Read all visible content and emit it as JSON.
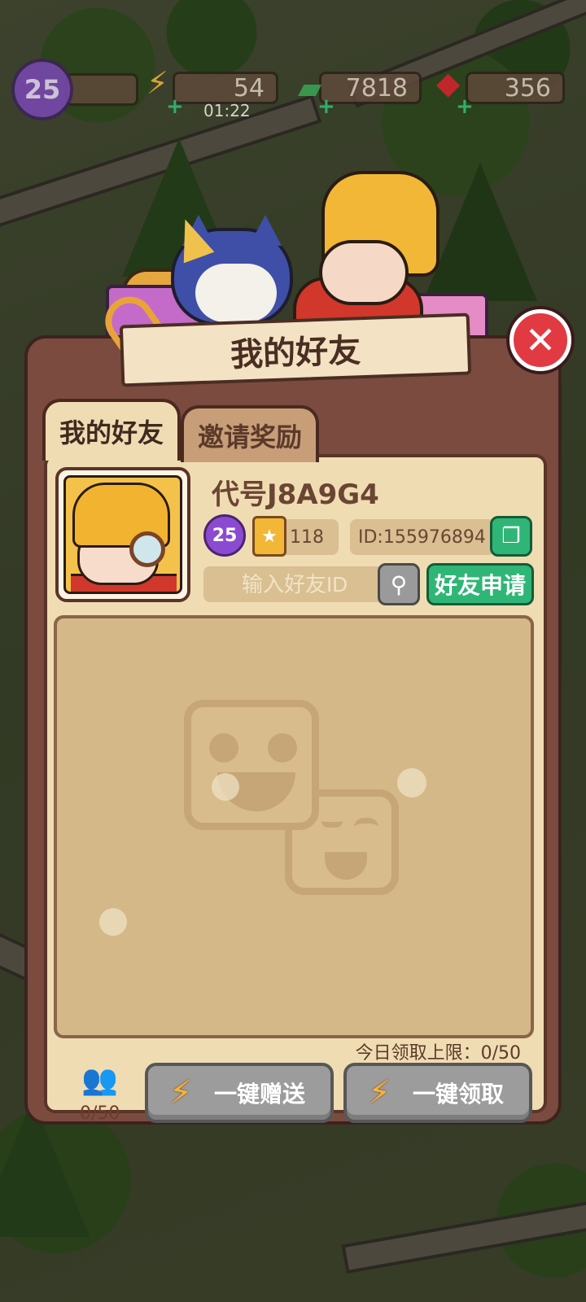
{
  "hud": {
    "level": "25",
    "energy": "54",
    "energy_timer": "01:22",
    "cash": "7818",
    "gems": "356",
    "icons": [
      "level-badge-icon",
      "lightning-icon",
      "cash-icon",
      "ruby-icon"
    ]
  },
  "dialog": {
    "title": "我的好友",
    "close_icon": "close-icon"
  },
  "tabs": [
    {
      "label": "我的好友",
      "active": true
    },
    {
      "label": "邀请奖励",
      "active": false
    }
  ],
  "profile": {
    "nickname": "代号J8A9G4",
    "level": "25",
    "collection_count": "118",
    "player_id": "ID:155976894"
  },
  "search": {
    "placeholder": "输入好友ID",
    "apply_label": "好友申请"
  },
  "footer": {
    "daily_limit": "今日领取上限：0/50",
    "friend_count": "0/50",
    "send_all_label": "一键赠送",
    "claim_all_label": "一键领取"
  },
  "colors": {
    "panel": "#7b4b40",
    "inner": "#f0dcb2",
    "accent_green": "#2fb676",
    "close_red": "#e23a43",
    "disabled_gray": "#9c9c9c"
  }
}
